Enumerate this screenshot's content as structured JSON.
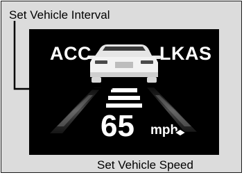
{
  "display": {
    "acc_label": "ACC",
    "lkas_label": "LKAS",
    "set_speed_value": "65",
    "set_speed_unit": "mph"
  },
  "callouts": {
    "interval_label": "Set Vehicle Interval",
    "speed_label": "Set Vehicle Speed"
  },
  "icons": {
    "vehicle": "vehicle-ahead-icon",
    "interval_bars": "following-interval-bars-icon",
    "lanes": "lane-markers-icon"
  },
  "colors": {
    "screen_bg": "#000000",
    "display_text": "#ffffff",
    "frame_bg": "#dcdcdc",
    "callout_text": "#000000"
  }
}
